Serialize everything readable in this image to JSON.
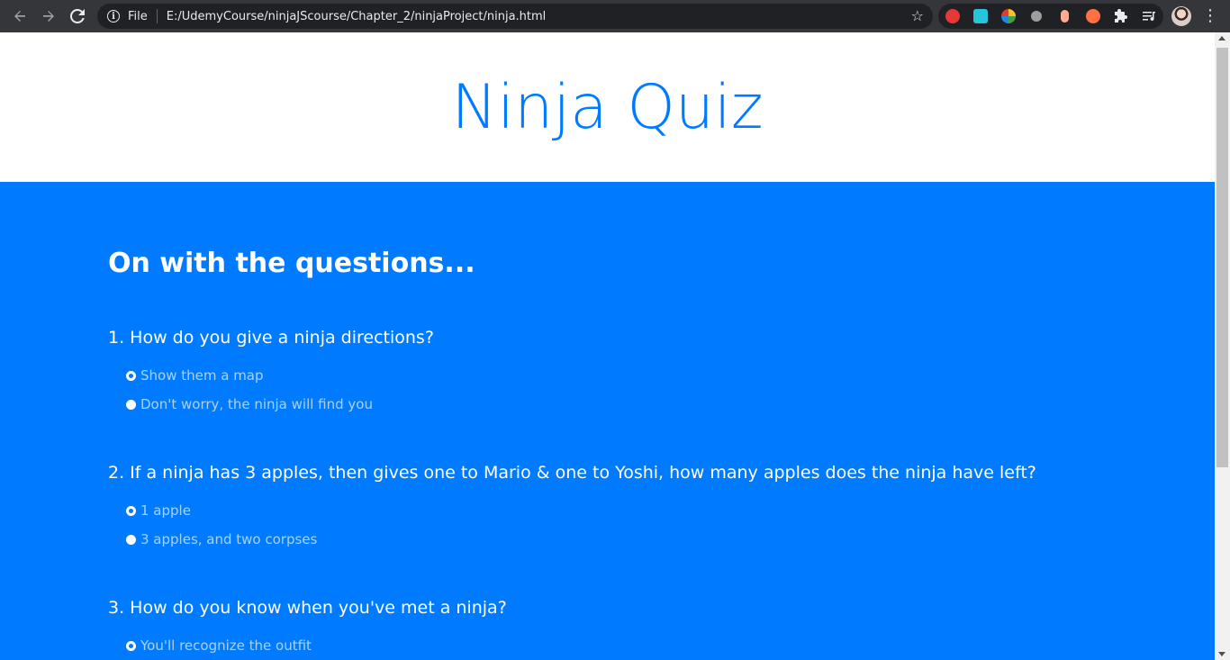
{
  "browser": {
    "scheme_label": "File",
    "url": "E:/UdemyCourse/ninjaJScourse/Chapter_2/ninjaProject/ninja.html",
    "extensions": [
      {
        "name": "hand-extension-icon",
        "color": "#e53935"
      },
      {
        "name": "translate-extension-icon",
        "color": "#26c6da"
      },
      {
        "name": "colorful-extension-icon",
        "color": "#fbc02d"
      },
      {
        "name": "user-check-extension-icon",
        "color": "#9e9e9e"
      },
      {
        "name": "capsule-extension-icon",
        "color": "#ffab91"
      },
      {
        "name": "fire-extension-icon",
        "color": "#ff7043"
      },
      {
        "name": "puzzle-icon",
        "color": "#e8eaed"
      },
      {
        "name": "reading-list-icon",
        "color": "#e8eaed"
      }
    ]
  },
  "page": {
    "title": "Ninja Quiz",
    "section_heading": "On with the questions...",
    "questions": [
      {
        "text": "1. How do you give a ninja directions?",
        "options": [
          {
            "label": "Show them a map",
            "checked": true
          },
          {
            "label": "Don't worry, the ninja will find you",
            "checked": false
          }
        ]
      },
      {
        "text": "2. If a ninja has 3 apples, then gives one to Mario & one to Yoshi, how many apples does the ninja have left?",
        "options": [
          {
            "label": "1 apple",
            "checked": true
          },
          {
            "label": "3 apples, and two corpses",
            "checked": false
          }
        ]
      },
      {
        "text": "3. How do you know when you've met a ninja?",
        "options": [
          {
            "label": "You'll recognize the outfit",
            "checked": true
          }
        ]
      }
    ]
  },
  "colors": {
    "accent": "#007bff",
    "option_text": "#a8d2ff"
  }
}
